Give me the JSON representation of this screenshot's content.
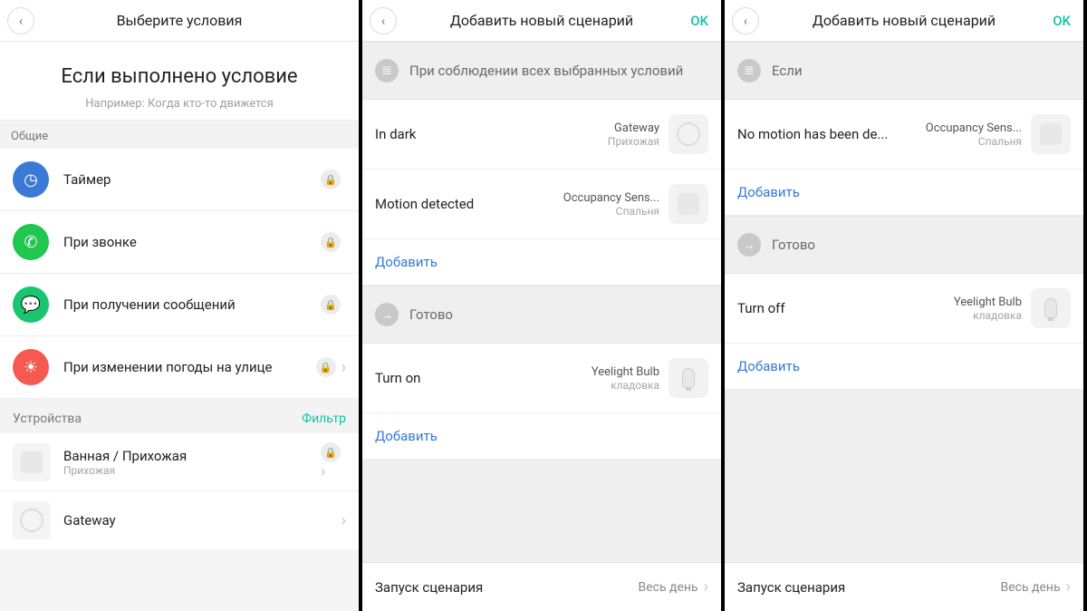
{
  "panel1": {
    "title": "Выберите условия",
    "heading": "Если выполнено условие",
    "subheading": "Например: Когда кто-то движется",
    "group_common": "Общие",
    "items": [
      {
        "label": "Таймер",
        "icon": "clock-icon",
        "color": "c-blue"
      },
      {
        "label": "При звонке",
        "icon": "phone-icon",
        "color": "c-green"
      },
      {
        "label": "При получении сообщений",
        "icon": "message-icon",
        "color": "c-green2"
      },
      {
        "label": "При изменении погоды на улице",
        "icon": "weather-icon",
        "color": "c-red"
      }
    ],
    "devices_label": "Устройства",
    "filter_label": "Фильтр",
    "devices": [
      {
        "name": "Ванная / Прихожая",
        "room": "Прихожая"
      },
      {
        "name": "Gateway",
        "room": ""
      }
    ]
  },
  "panel2": {
    "title": "Добавить новый сценарий",
    "ok": "OK",
    "if_header": "При соблюдении всех выбранных условий",
    "done_header": "Готово",
    "add_label": "Добавить",
    "conditions": [
      {
        "title": "In dark",
        "device": "Gateway",
        "room": "Прихожая"
      },
      {
        "title": "Motion detected",
        "device": "Occupancy Sens...",
        "room": "Спальня"
      }
    ],
    "actions": [
      {
        "title": "Turn on",
        "device": "Yeelight Bulb",
        "room": "кладовка"
      }
    ],
    "footer_label": "Запуск сценария",
    "footer_value": "Весь день"
  },
  "panel3": {
    "title": "Добавить новый сценарий",
    "ok": "OK",
    "if_header": "Если",
    "done_header": "Готово",
    "add_label": "Добавить",
    "conditions": [
      {
        "title": "No motion has been de...",
        "device": "Occupancy Sens...",
        "room": "Спальня"
      }
    ],
    "actions": [
      {
        "title": "Turn off",
        "device": "Yeelight Bulb",
        "room": "кладовка"
      }
    ],
    "footer_label": "Запуск сценария",
    "footer_value": "Весь день"
  }
}
